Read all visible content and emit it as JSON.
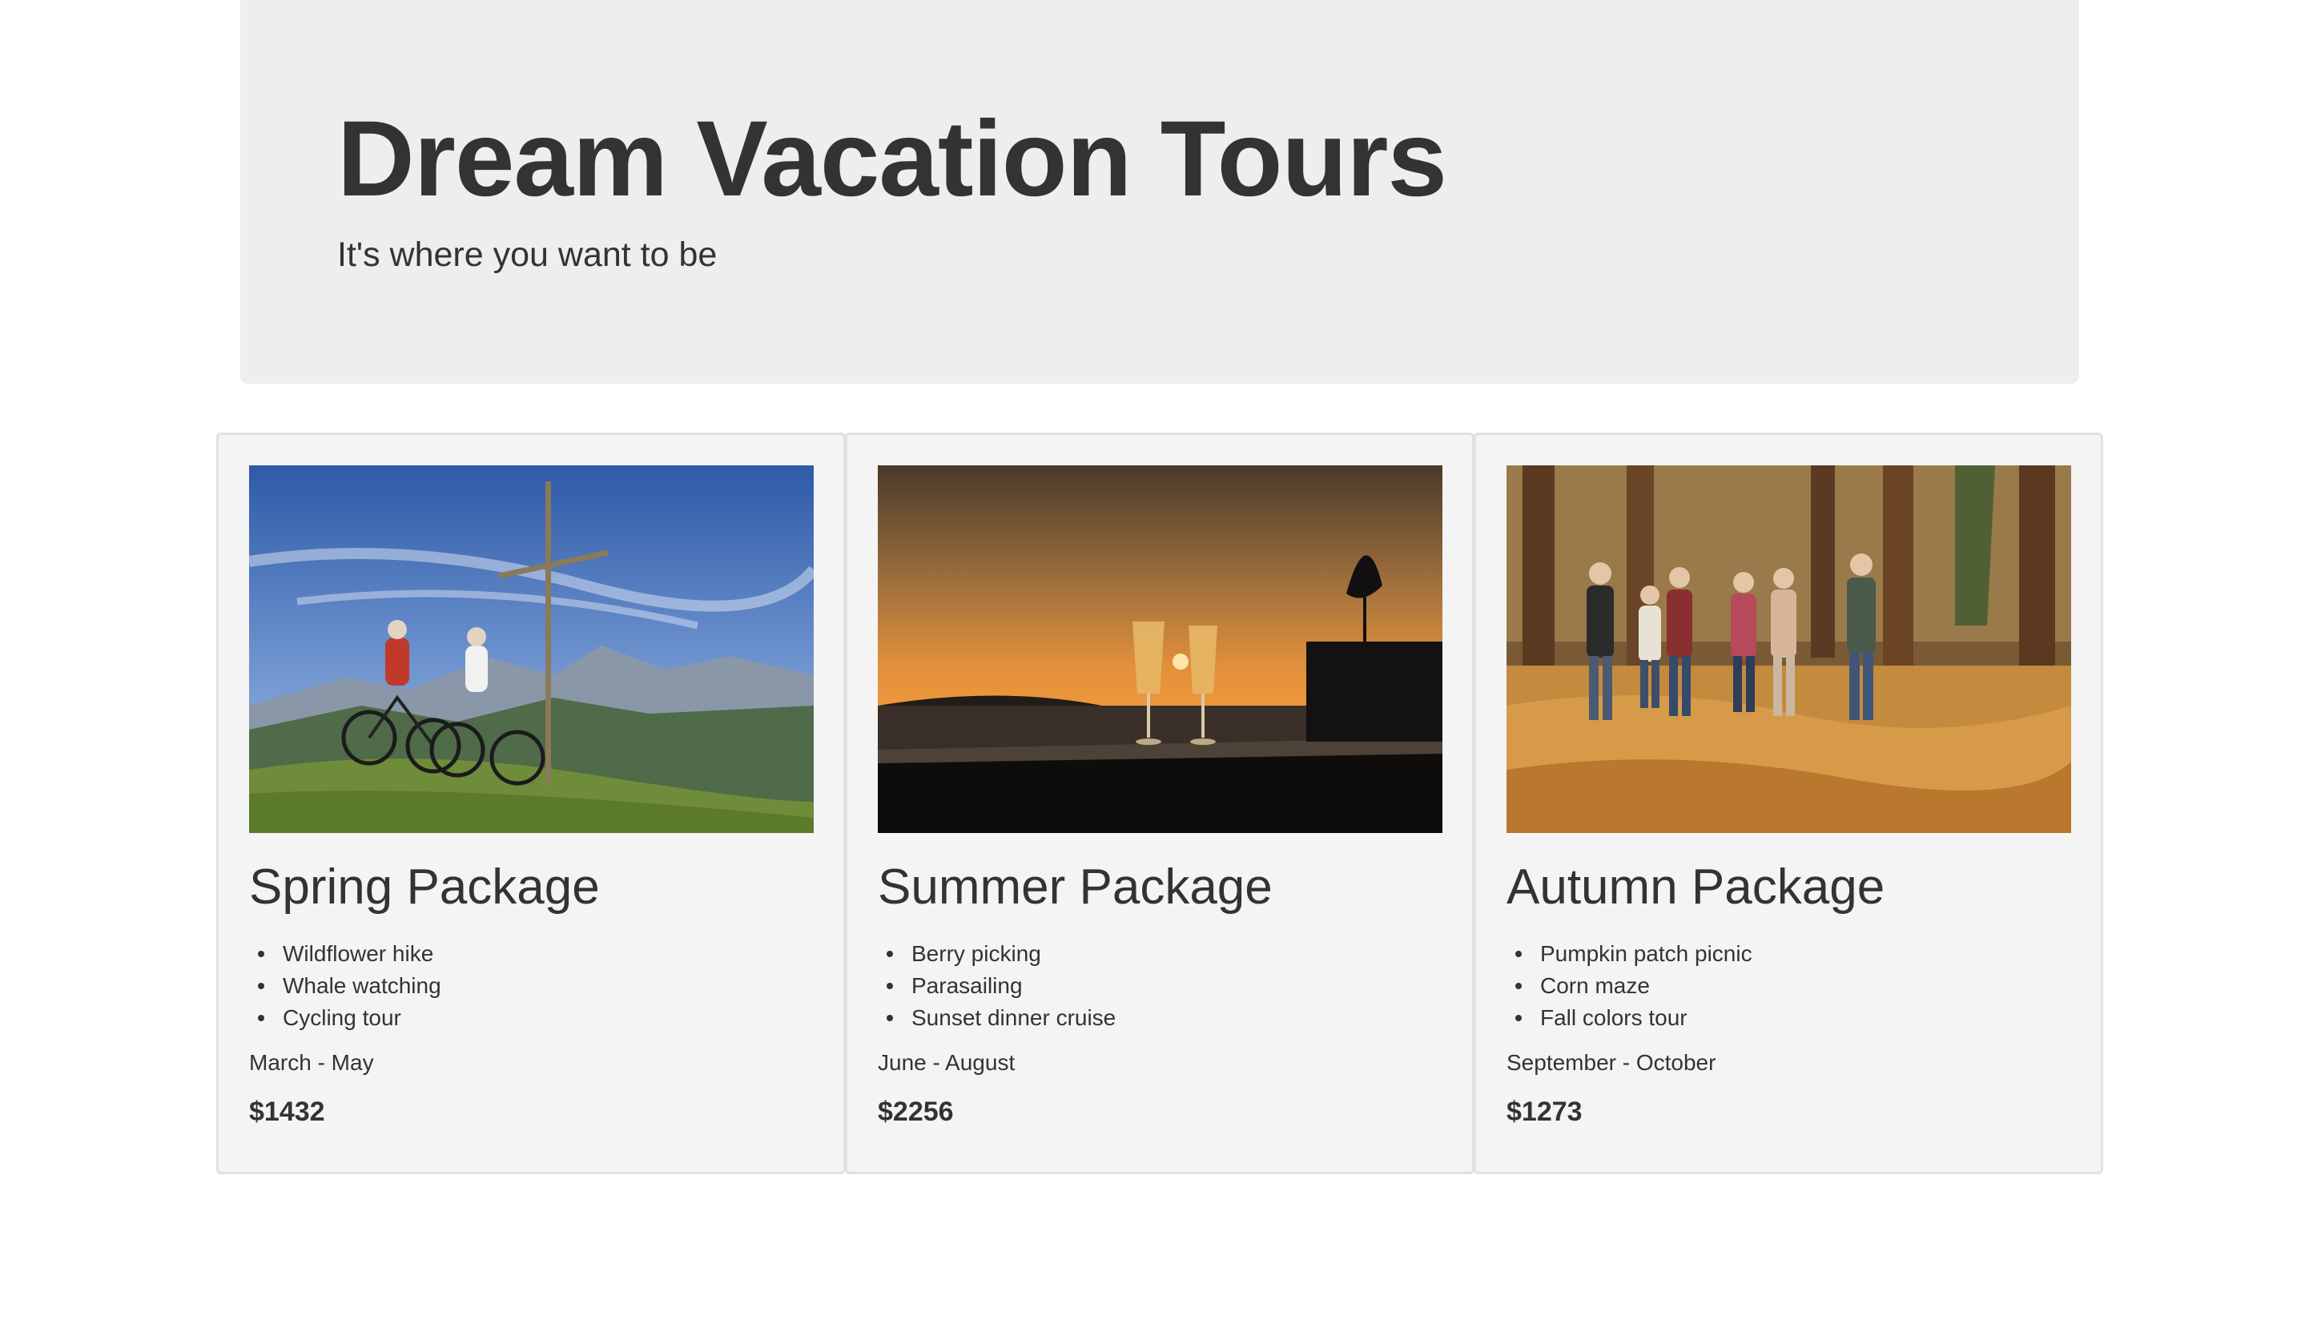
{
  "header": {
    "title": "Dream Vacation Tours",
    "subtitle": "It's where you want to be",
    "background_color": "#eeeeee"
  },
  "packages": [
    {
      "name": "Spring Package",
      "image": "photo-cyclists-mountain-cross",
      "activities": [
        "Wildflower hike",
        "Whale watching",
        "Cycling tour"
      ],
      "season": "March - May",
      "price": "$1432"
    },
    {
      "name": "Summer Package",
      "image": "photo-champagne-sunset-sea",
      "activities": [
        "Berry picking",
        "Parasailing",
        "Sunset dinner cruise"
      ],
      "season": "June - August",
      "price": "$2256"
    },
    {
      "name": "Autumn Package",
      "image": "photo-family-autumn-forest-walk",
      "activities": [
        "Pumpkin patch picnic",
        "Corn maze",
        "Fall colors tour"
      ],
      "season": "September - October",
      "price": "$1273"
    }
  ],
  "colors": {
    "text": "#333333",
    "card_background": "#f4f4f4",
    "card_border": "#e1e1e1"
  }
}
